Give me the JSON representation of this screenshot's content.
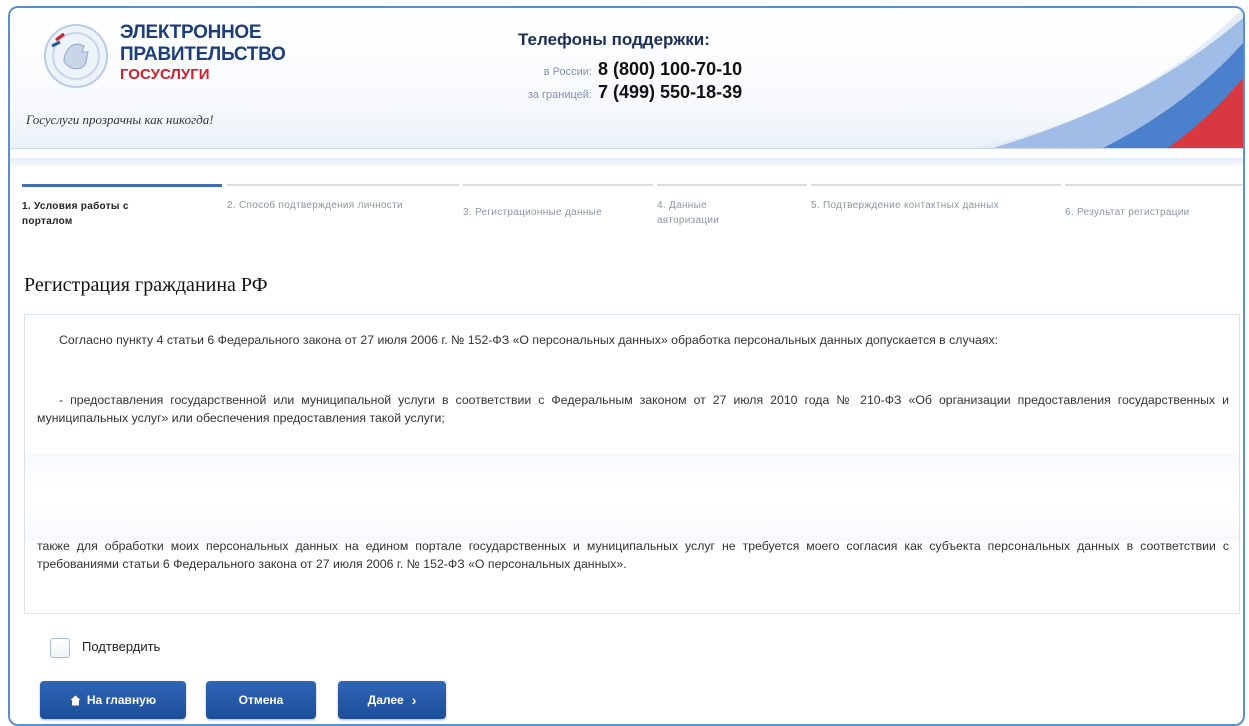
{
  "header": {
    "logo_line1": "ЭЛЕКТРОННОЕ",
    "logo_line2": "ПРАВИТЕЛЬСТВО",
    "logo_line3": "ГОСУСЛУГИ",
    "slogan": "Госуслуги прозрачны как никогда!",
    "support_title": "Телефоны поддержки:",
    "russia_label": "в России:",
    "russia_phone": "8 (800) 100-70-10",
    "abroad_label": "за границей:",
    "abroad_phone": "7 (499) 550-18-39"
  },
  "steps": [
    {
      "label": "1. Условия работы с порталом",
      "active": true
    },
    {
      "label": "2. Способ подтверждения личности",
      "active": false
    },
    {
      "label": "3. Регистрационные данные",
      "active": false
    },
    {
      "label": "4. Данные авторизации",
      "active": false
    },
    {
      "label": "5. Подтверждение контактных данных",
      "active": false
    },
    {
      "label": "6. Результат регистрации",
      "active": false
    }
  ],
  "page_title": "Регистрация гражданина РФ",
  "terms": {
    "p1": "Согласно пункту 4 статьи 6 Федерального закона от 27 июля 2006 г. № 152-ФЗ «О персональных данных» обработка персональных данных допускается в случаях:",
    "p2": "- предоставления государственной или муниципальной услуги в соответствии с Федеральным законом от 27 июля 2010 года № 210-ФЗ «Об организации предоставления государственных и муниципальных услуг» или обеспечения предоставления такой услуги;",
    "p3": "также для обработки моих персональных данных на едином портале государственных и муниципальных услуг не требуется моего согласия как субъекта персональных данных в соответствии с требованиями статьи 6 Федерального закона от 27 июля 2006 г. № 152-ФЗ «О персональных данных»."
  },
  "confirm_label": "Подтвердить",
  "buttons": {
    "home": "На главную",
    "cancel": "Отмена",
    "next": "Далее"
  },
  "colors": {
    "brand_blue": "#1d3e7a",
    "brand_red": "#d0202a",
    "button_blue": "#2459a8",
    "frame_border": "#5b8fd3"
  }
}
